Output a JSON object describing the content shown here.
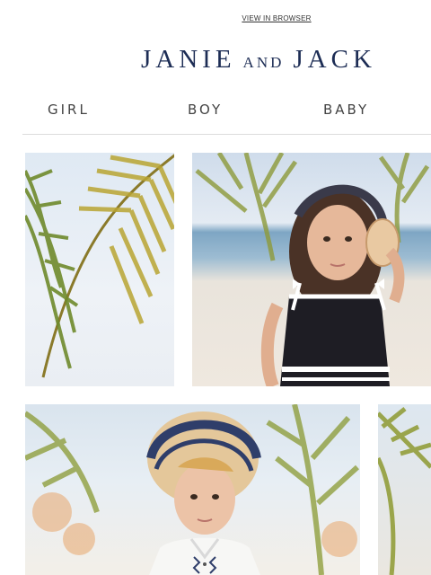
{
  "header": {
    "view_in_browser": "VIEW IN BROWSER",
    "logo": {
      "word1": "JANIE",
      "conjunction": "AND",
      "word2": "JACK"
    }
  },
  "nav": {
    "items": [
      {
        "label": "GIRL"
      },
      {
        "label": "BOY"
      },
      {
        "label": "BABY"
      }
    ]
  },
  "colors": {
    "brand_navy": "#1d2d55",
    "nav_text": "#444444",
    "divider": "#dcdcdc"
  },
  "images": [
    {
      "subject": "palm-frond-photo"
    },
    {
      "subject": "girl-with-seashell-photo"
    },
    {
      "subject": "boy-in-sun-hat-photo"
    },
    {
      "subject": "palm-edge-photo"
    }
  ]
}
